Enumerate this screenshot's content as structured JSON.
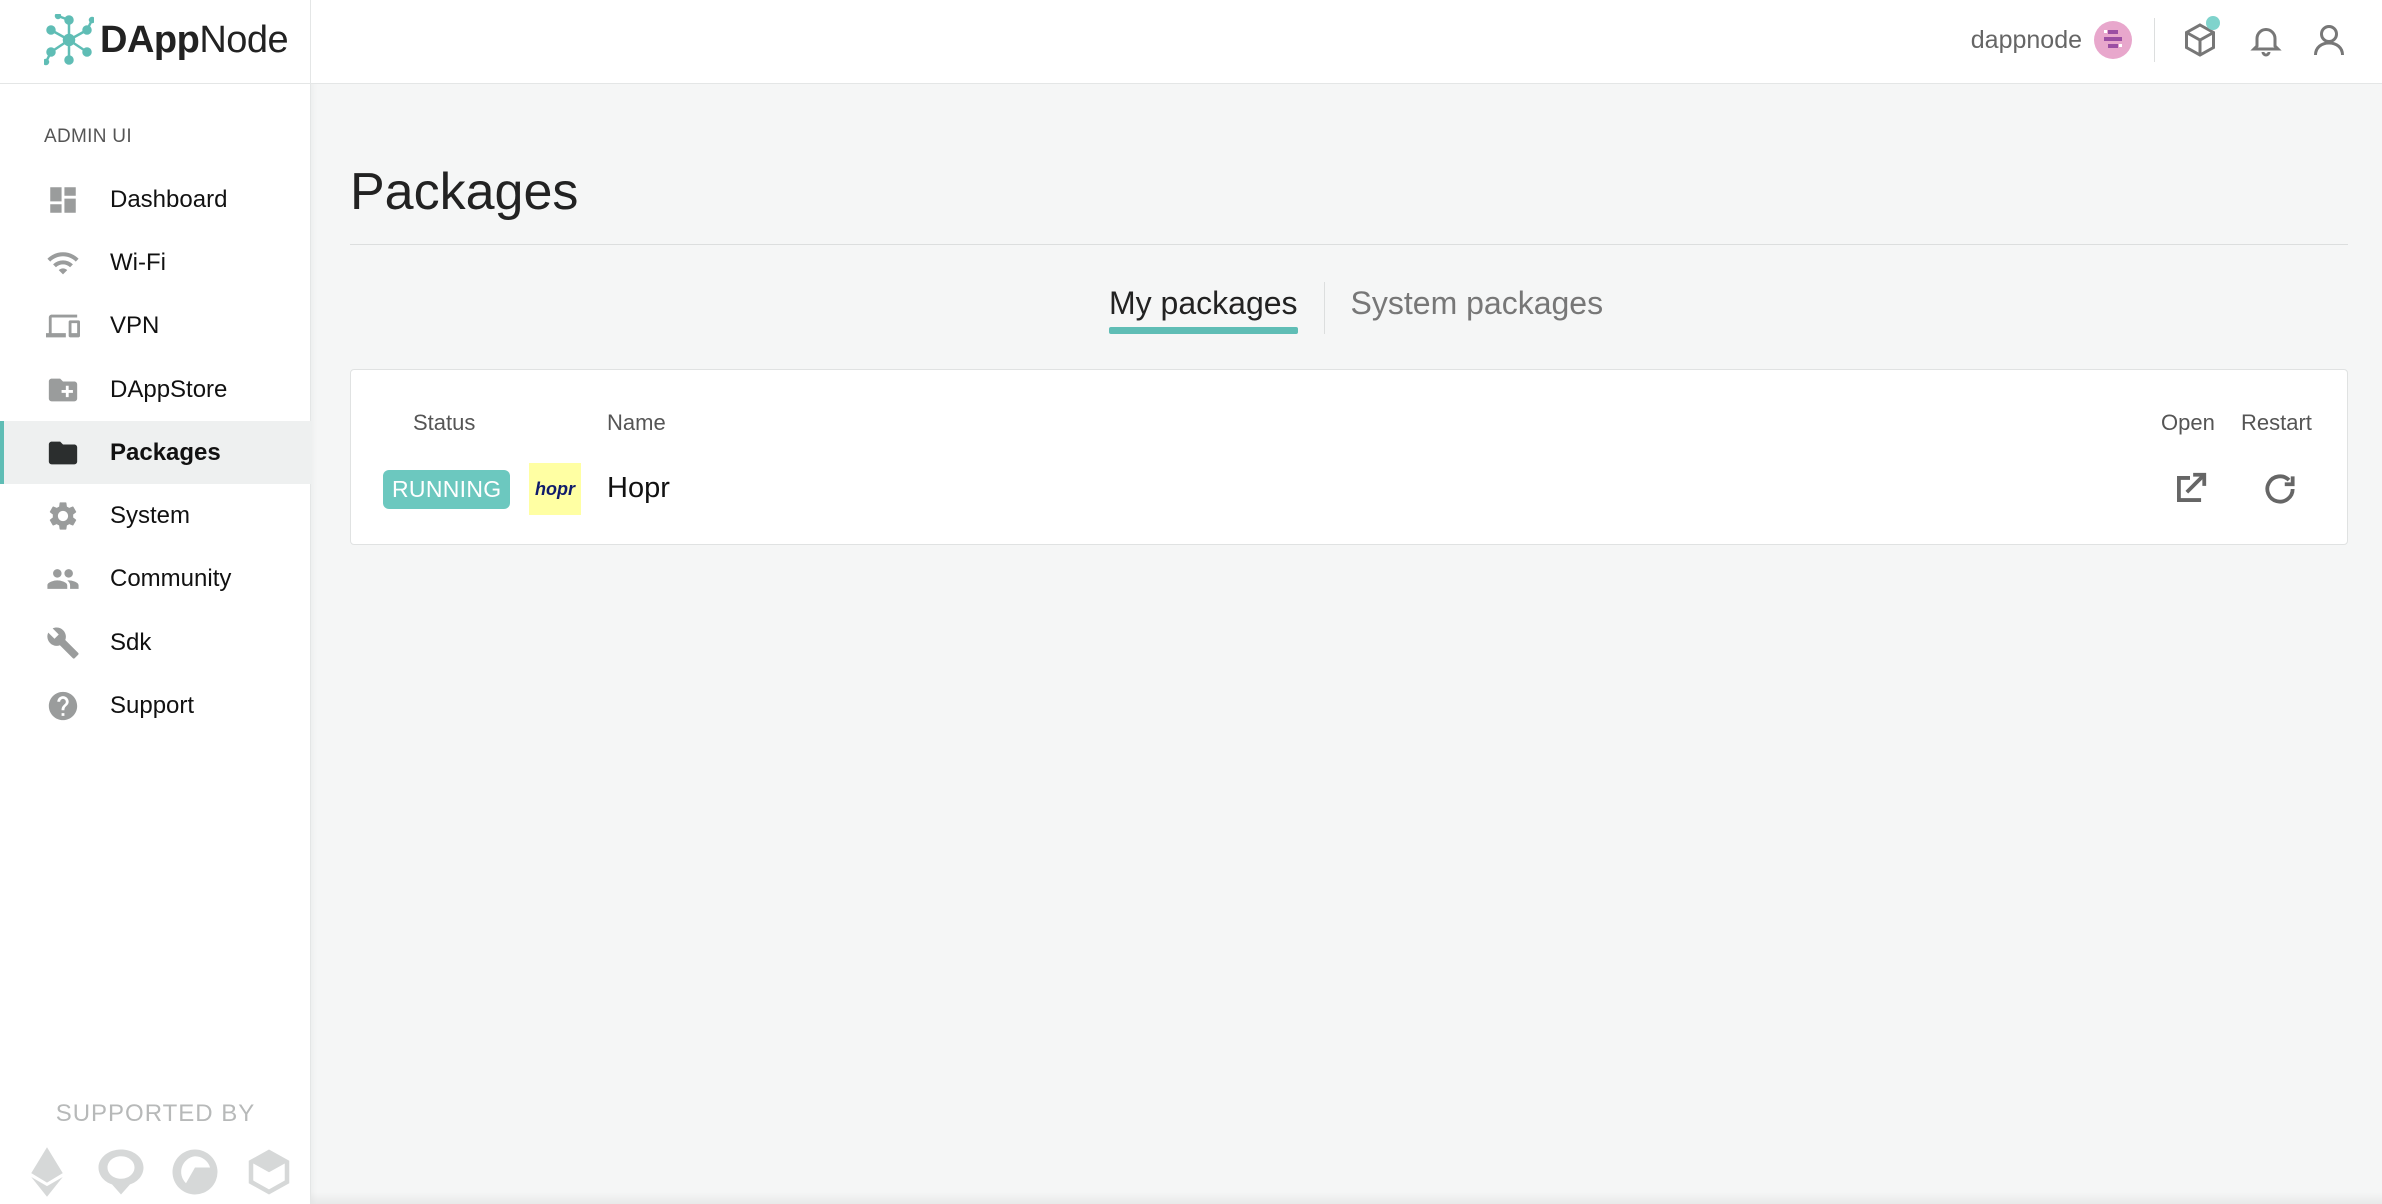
{
  "app": {
    "logo_bold": "DApp",
    "logo_regular": "Node"
  },
  "sidebar": {
    "section_label": "ADMIN UI",
    "items": [
      {
        "label": "Dashboard",
        "icon": "dashboard-icon"
      },
      {
        "label": "Wi-Fi",
        "icon": "wifi-icon"
      },
      {
        "label": "VPN",
        "icon": "devices-icon"
      },
      {
        "label": "DAppStore",
        "icon": "folder-add-icon"
      },
      {
        "label": "Packages",
        "icon": "folder-icon",
        "active": true
      },
      {
        "label": "System",
        "icon": "gear-icon"
      },
      {
        "label": "Community",
        "icon": "people-icon"
      },
      {
        "label": "Sdk",
        "icon": "wrench-icon"
      },
      {
        "label": "Support",
        "icon": "help-icon"
      }
    ],
    "supported_by": "SUPPORTED BY",
    "sponsors": [
      "ethereum-logo",
      "sponsor-logo-2",
      "sponsor-logo-3",
      "sponsor-logo-4"
    ]
  },
  "topbar": {
    "username": "dappnode",
    "icons": [
      "avatar",
      "package-icon",
      "bell-icon",
      "user-icon"
    ],
    "notification_dot_color": "#7fd3cc"
  },
  "main": {
    "title": "Packages",
    "tabs": [
      {
        "label": "My packages",
        "active": true
      },
      {
        "label": "System packages",
        "active": false
      }
    ],
    "table": {
      "headers": {
        "status": "Status",
        "name": "Name",
        "open": "Open",
        "restart": "Restart"
      },
      "rows": [
        {
          "status": "RUNNING",
          "logo_text": "hopr",
          "name": "Hopr"
        }
      ]
    }
  },
  "colors": {
    "accent": "#5fbdb5",
    "running_badge": "#6cc8bf",
    "hopr_logo_bg": "#ffffa3"
  }
}
